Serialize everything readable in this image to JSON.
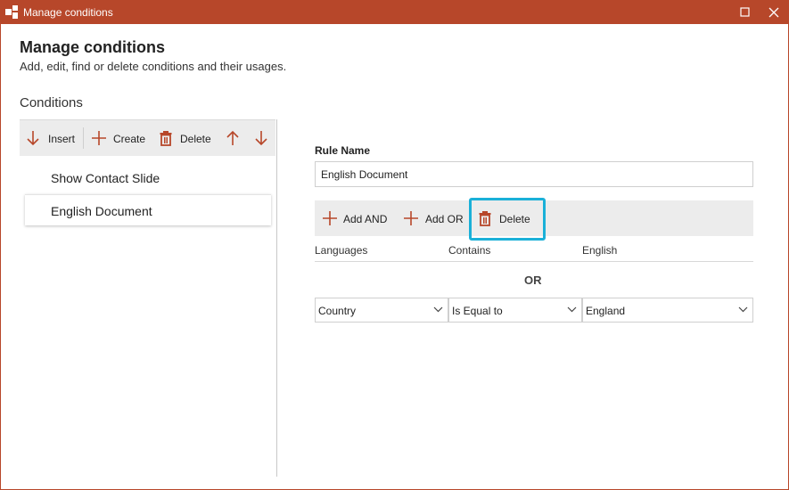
{
  "window": {
    "title": "Manage conditions",
    "accent_color": "#b7472a",
    "controls": [
      "maximize-icon",
      "close-icon"
    ]
  },
  "header": {
    "title": "Manage conditions",
    "subtitle": "Add, edit, find or delete conditions and their usages."
  },
  "conditions": {
    "label": "Conditions",
    "toolbar": {
      "insert_label": "Insert",
      "create_label": "Create",
      "delete_label": "Delete",
      "move_up_icon": "arrow-up-icon",
      "move_down_icon": "arrow-down-icon"
    },
    "items": [
      {
        "label": "Show Contact Slide",
        "selected": false
      },
      {
        "label": "English Document",
        "selected": true
      }
    ]
  },
  "rule": {
    "name_label": "Rule Name",
    "name_value": "English Document",
    "toolbar": {
      "add_and_label": "Add AND",
      "add_or_label": "Add OR",
      "delete_label": "Delete",
      "highlight_color": "#1ab0d8"
    },
    "condition_1": {
      "field": "Languages",
      "operator": "Contains",
      "value": "English"
    },
    "connector": "OR",
    "condition_2": {
      "field": "Country",
      "operator": "Is Equal to",
      "value": "England"
    }
  }
}
